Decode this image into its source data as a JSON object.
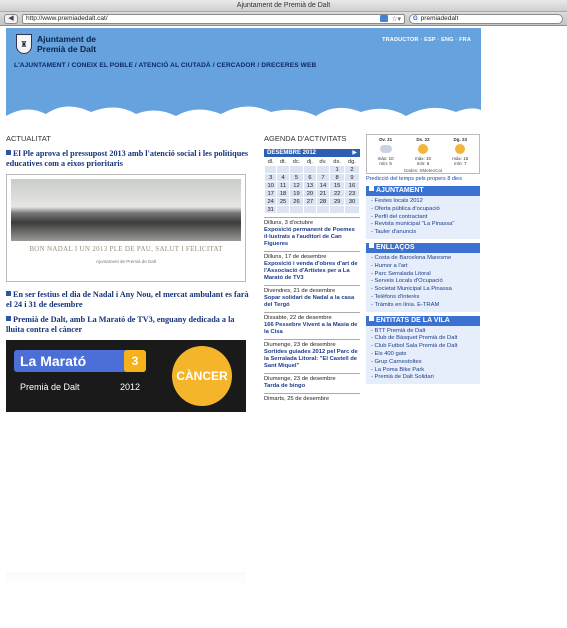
{
  "window": {
    "title": "Ajuntament de Premià de Dalt"
  },
  "browser": {
    "url": "http://www.premiadedalt.cat/",
    "search_value": "premiadedalt",
    "search_engine": "G"
  },
  "site": {
    "logo_line1": "Ajuntament de",
    "logo_line2": "Premià de Dalt",
    "lang_links": "TRADUCTOR · ESP · ENG · FRA",
    "nav": "L'AJUNTAMENT / CONEIX EL POBLE / ATENCIÓ AL CIUTADÀ / CERCADOR / DRECERES WEB"
  },
  "news": {
    "section_title": "ACTUALITAT",
    "items": [
      "El Ple aprova el pressupost 2013 amb l'atenció social i les polítiques educatives com a eixos prioritaris",
      "En ser festius el dia de Nadal i Any Nou, el mercat ambulant es farà el 24 i 31 de desembre",
      "Premià de Dalt, amb La Marató de TV3, enguany dedicada a la lluita contra el càncer"
    ],
    "photo_caption": "BON NADAL I UN 2013 PLE DE PAU, SALUT I FELICITAT",
    "photo_footer": "Ajuntament de Premià de Dalt",
    "banner": {
      "title": "La Marató",
      "channel": "3",
      "place": "Premià de Dalt",
      "year": "2012",
      "cause": "CÀNCER"
    }
  },
  "agenda": {
    "section_title": "AGENDA D'ACTIVITATS",
    "month": "DESEMBRE 2012",
    "next_icon": "play-icon",
    "weekdays": [
      "dl.",
      "dt.",
      "dc.",
      "dj.",
      "dv.",
      "ds.",
      "dg."
    ],
    "weeks": [
      [
        "",
        "",
        "",
        "",
        "",
        "1",
        "2"
      ],
      [
        "3",
        "4",
        "5",
        "6",
        "7",
        "8",
        "9"
      ],
      [
        "10",
        "11",
        "12",
        "13",
        "14",
        "15",
        "16"
      ],
      [
        "17",
        "18",
        "19",
        "20",
        "21",
        "22",
        "23"
      ],
      [
        "24",
        "25",
        "26",
        "27",
        "28",
        "29",
        "30"
      ],
      [
        "31",
        "",
        "",
        "",
        "",
        "",
        ""
      ]
    ],
    "events": [
      {
        "date": "Dilluns, 3 d'octubre",
        "title": "Exposició permanent de Poemes il·lustrats a l'auditori de Can Figueres"
      },
      {
        "date": "Dilluns, 17 de desembre",
        "title": "Exposició i venda d'obres d'art de l'Associació d'Artistes per a La Marató de TV3"
      },
      {
        "date": "Divendres, 21 de desembre",
        "title": "Sopar solidari de Nadal a la casa del Tergó"
      },
      {
        "date": "Dissabte, 22 de desembre",
        "title": "166 Pessebre Vivent a la Masia de la Cisa"
      },
      {
        "date": "Diumenge, 23 de desembre",
        "title": "Sortides guiades 2012 pel Parc de la Serralada Litoral: \"El Castell de Sant Miquel\""
      },
      {
        "date": "Diumenge, 23 de desembre",
        "title": "Tarda de bingo"
      },
      {
        "date": "Dimarts, 25 de desembre",
        "title": ""
      }
    ]
  },
  "weather": {
    "days": [
      {
        "day": "Dv. 21",
        "max": "màx: 10",
        "min": "mín: 5"
      },
      {
        "day": "Ds. 22",
        "max": "màx: 10",
        "min": "mín: 6"
      },
      {
        "day": "Dg. 23",
        "max": "màx: 16",
        "min": "mín: 7"
      }
    ],
    "source": "Dades: SMeteoCat",
    "more_link": "Predicció del temps pels propers 8 dies"
  },
  "boxes": [
    {
      "title": "AJUNTAMENT",
      "items": [
        "Festes locals 2012",
        "Oferta pública d'ocupació",
        "Perfil del contractant",
        "Revista municipal \"La Pinassa\"",
        "Tauler d'anuncis"
      ]
    },
    {
      "title": "ENLLAÇOS",
      "items": [
        "Costa de Barcelona Maresme",
        "Humor a l'art",
        "Parc Serralada Litoral",
        "Serveis Locals d'Ocupació",
        "Societat Municipal La Pinassa",
        "Telèfons d'interès",
        "Tràmits en línia. E-TRAM"
      ]
    },
    {
      "title": "ENTITATS DE LA VILA",
      "items": [
        "BTT Premià de Dalt",
        "Club de Bàsquet Premià de Dalt",
        "Club Futbol Sala Premià de Dalt",
        "Els 400 gats",
        "Grup Carnestoltes",
        "La Poma Bike Park",
        "Premià de Dalt Solidari"
      ]
    }
  ],
  "colors": {
    "header_blue": "#66a2dd",
    "link_blue": "#14347a",
    "box_title": "#3b72d2"
  }
}
